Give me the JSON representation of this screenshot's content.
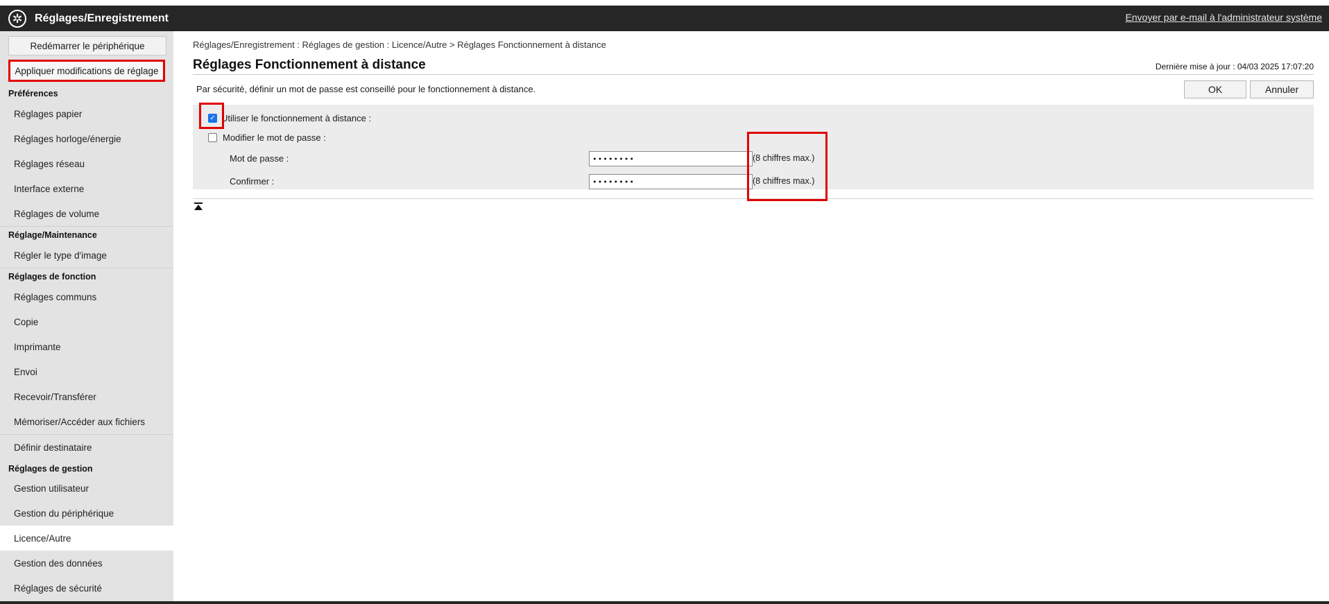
{
  "header": {
    "title": "Réglages/Enregistrement",
    "mail_link": "Envoyer par e-mail à l'administrateur système",
    "logo_icon": "settings-wheel-icon"
  },
  "sidebar": {
    "restart_button": "Redémarrer le périphérique",
    "apply_button": "Appliquer modifications de réglage",
    "sections": [
      {
        "title": "Préférences",
        "items": [
          "Réglages papier",
          "Réglages horloge/énergie",
          "Réglages réseau",
          "Interface externe",
          "Réglages de volume"
        ]
      },
      {
        "title": "Réglage/Maintenance",
        "items": [
          "Régler le type d'image"
        ]
      },
      {
        "title": "Réglages de fonction",
        "items": [
          "Réglages communs",
          "Copie",
          "Imprimante",
          "Envoi",
          "Recevoir/Transférer",
          "Mémoriser/Accéder aux fichiers",
          "Définir destinataire"
        ]
      },
      {
        "title": "Réglages de gestion",
        "items": [
          "Gestion utilisateur",
          "Gestion du périphérique",
          "Licence/Autre",
          "Gestion des données",
          "Réglages de sécurité"
        ]
      }
    ],
    "active_item": "Licence/Autre"
  },
  "main": {
    "breadcrumb": "Réglages/Enregistrement : Réglages de gestion : Licence/Autre > Réglages Fonctionnement à distance",
    "title": "Réglages Fonctionnement à distance",
    "last_update": "Dernière mise à jour : 04/03 2025 17:07:20",
    "notice": "Par sécurité, définir un mot de passe est conseillé pour le fonctionnement à distance.",
    "ok_button": "OK",
    "cancel_button": "Annuler",
    "use_remote_label": "Utiliser le fonctionnement à distance :",
    "use_remote_checked": true,
    "change_password_label": "Modifier le mot de passe :",
    "change_password_checked": false,
    "password_label": "Mot de passe :",
    "password_value": "••••••••",
    "password_hint": "(8 chiffres max.)",
    "confirm_label": "Confirmer :",
    "confirm_value": "••••••••",
    "confirm_hint": "(8 chiffres max.)"
  },
  "colors": {
    "topbar": "#262626",
    "sidebar": "#e3e3e3",
    "highlight": "#e00000",
    "checkbox_checked": "#1a73e8"
  }
}
